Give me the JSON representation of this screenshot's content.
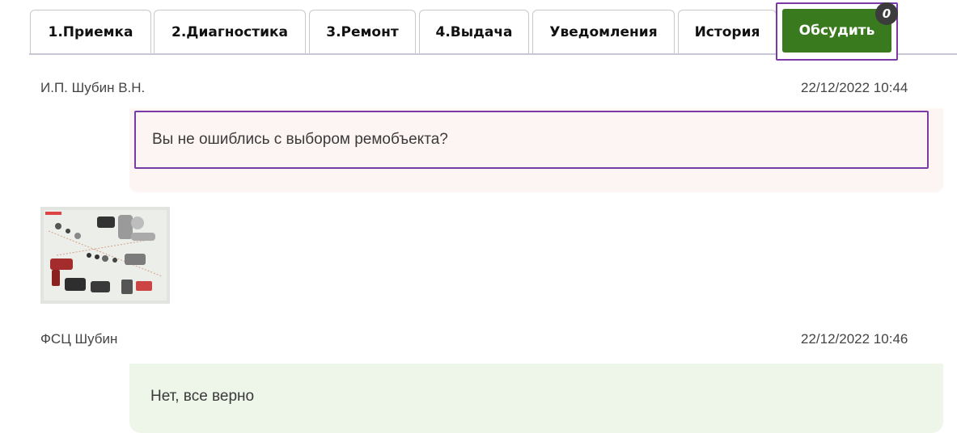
{
  "tabs": [
    {
      "label": "1.Приемка"
    },
    {
      "label": "2.Диагностика"
    },
    {
      "label": "3.Ремонт"
    },
    {
      "label": "4.Выдача"
    },
    {
      "label": "Уведомления"
    },
    {
      "label": "История"
    },
    {
      "label": "Обсудить",
      "active": true,
      "badge": "0"
    }
  ],
  "messages": [
    {
      "author": "И.П. Шубин В.Н.",
      "timestamp": "22/12/2022 10:44",
      "text": "Вы не ошиблись с выбором ремобъекта?"
    },
    {
      "author": "ФСЦ Шубин",
      "timestamp": "22/12/2022 10:46",
      "text": "Нет, все верно"
    }
  ],
  "colors": {
    "active_tab": "#3a7a1e",
    "highlight_border": "#7b3aa6",
    "admin_bubble": "#fdf5f3",
    "user_bubble": "#eef5e9"
  }
}
